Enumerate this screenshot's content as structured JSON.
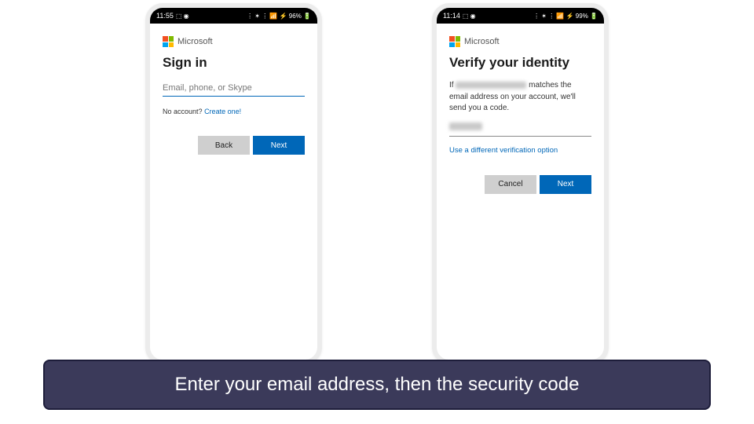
{
  "phone1": {
    "status": {
      "time": "11:55",
      "tray": "⬚ ◉",
      "right": "⋮ ✶ ⋮ 📶 ⚡ 96% 🔋"
    },
    "brand": "Microsoft",
    "heading": "Sign in",
    "placeholder": "Email, phone, or Skype",
    "noacct": "No account?",
    "create": "Create one!",
    "back": "Back",
    "next": "Next"
  },
  "phone2": {
    "status": {
      "time": "11:14",
      "tray": "⬚ ◉",
      "right": "⋮ ✶ ⋮ 📶 ⚡ 99% 🔋"
    },
    "brand": "Microsoft",
    "heading": "Verify your identity",
    "body_pre": "If ",
    "body_post": " matches the email address on your account, we'll send you a code.",
    "diff": "Use a different verification option",
    "cancel": "Cancel",
    "next": "Next"
  },
  "caption": "Enter your email address, then the security code"
}
